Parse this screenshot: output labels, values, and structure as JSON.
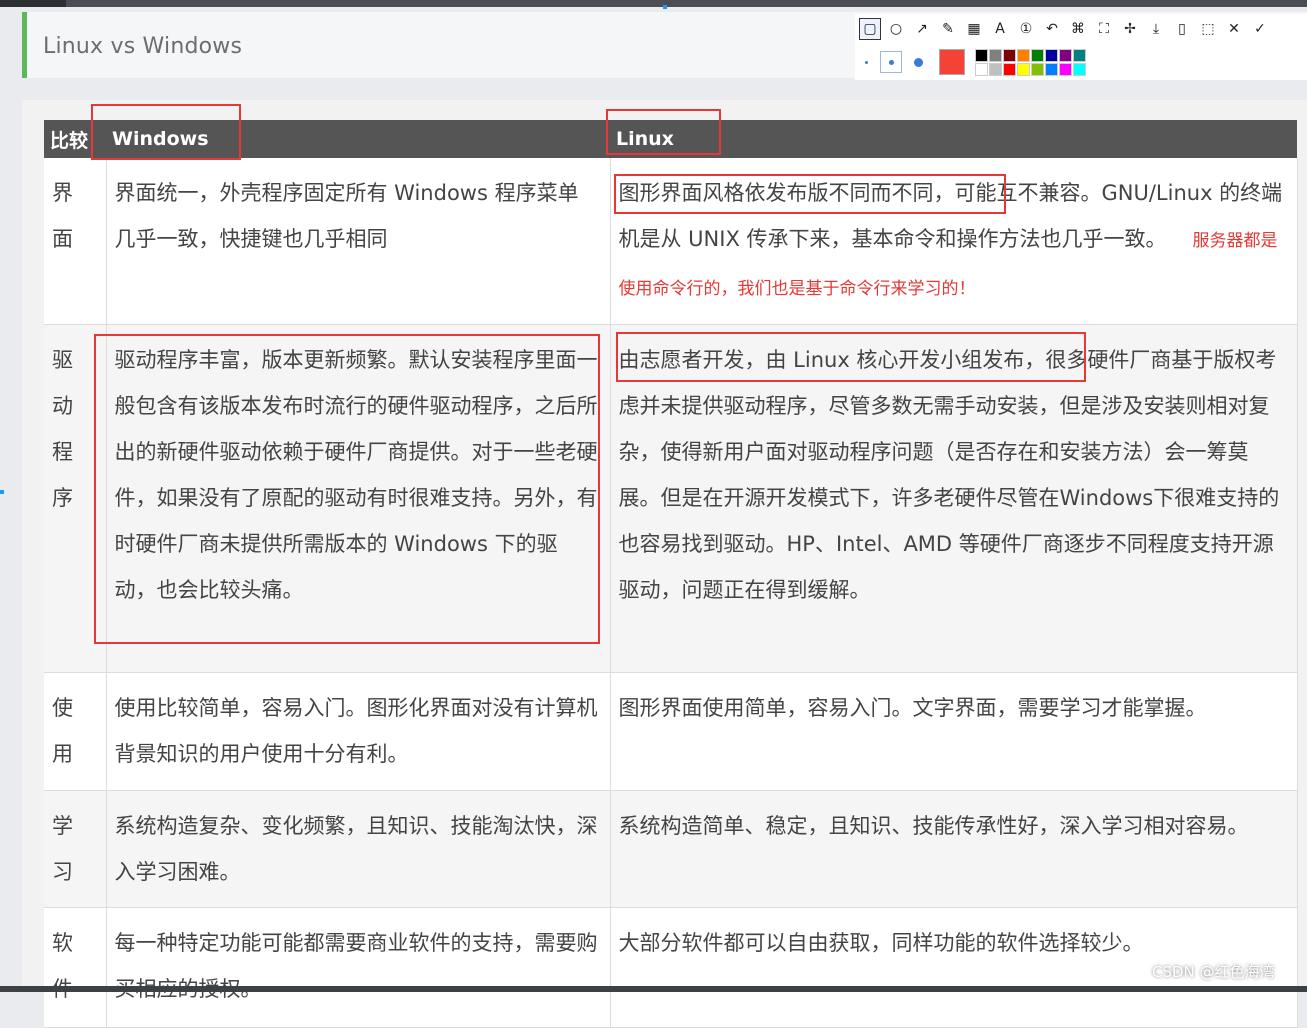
{
  "heading": {
    "title": "Linux vs Windows"
  },
  "toolbar": {
    "tools": [
      {
        "icon": "rectangle-icon",
        "glyph": "▢",
        "active": true
      },
      {
        "icon": "ellipse-icon",
        "glyph": "○"
      },
      {
        "icon": "arrow-icon",
        "glyph": "↗"
      },
      {
        "icon": "pen-icon",
        "glyph": "✎"
      },
      {
        "icon": "mosaic-icon",
        "glyph": "▦"
      },
      {
        "icon": "text-icon",
        "glyph": "A"
      },
      {
        "icon": "number-marker-icon",
        "glyph": "①"
      },
      {
        "icon": "undo-icon",
        "glyph": "↶"
      },
      {
        "icon": "pin-tool-icon",
        "glyph": "⌘"
      },
      {
        "icon": "crop-icon",
        "glyph": "⛶"
      },
      {
        "icon": "pin-icon",
        "glyph": "✢"
      },
      {
        "icon": "download-icon",
        "glyph": "⤓"
      },
      {
        "icon": "save-icon",
        "glyph": "▯"
      },
      {
        "icon": "bookmark-icon",
        "glyph": "⬚"
      },
      {
        "icon": "close-icon",
        "glyph": "✕"
      },
      {
        "icon": "confirm-icon",
        "glyph": "✓"
      }
    ],
    "selected_color": "#f44336",
    "palette": [
      "#000000",
      "#808080",
      "#800000",
      "#ff8000",
      "#008000",
      "#0000a0",
      "#800080",
      "#008080",
      "#ffffff",
      "#c0c0c0",
      "#ff0000",
      "#ffff00",
      "#80c000",
      "#0080ff",
      "#ff00ff",
      "#00ffff"
    ]
  },
  "table": {
    "headers": [
      "比较",
      "Windows",
      "Linux"
    ],
    "rows": [
      {
        "category": [
          "界",
          "面"
        ],
        "windows": "界面统一，外壳程序固定所有 Windows 程序菜单几乎一致，快捷键也几乎相同",
        "linux": "图形界面风格依发布版不同而不同，可能互不兼容。GNU/Linux 的终端机是从 UNIX 传承下来，基本命令和操作方法也几乎一致。",
        "note": "服务器都是使用命令行的，我们也是基于命令行来学习的！"
      },
      {
        "category": [
          "驱",
          "动",
          "程",
          "序"
        ],
        "windows": "驱动程序丰富，版本更新频繁。默认安装程序里面一般包含有该版本发布时流行的硬件驱动程序，之后所出的新硬件驱动依赖于硬件厂商提供。对于一些老硬件，如果没有了原配的驱动有时很难支持。另外，有时硬件厂商未提供所需版本的 Windows 下的驱动，也会比较头痛。",
        "linux": "由志愿者开发，由 Linux 核心开发小组发布，很多硬件厂商基于版权考虑并未提供驱动程序，尽管多数无需手动安装，但是涉及安装则相对复杂，使得新用户面对驱动程序问题（是否存在和安装方法）会一筹莫展。但是在开源开发模式下，许多老硬件尽管在Windows下很难支持的也容易找到驱动。HP、Intel、AMD 等硬件厂商逐步不同程度支持开源驱动，问题正在得到缓解。"
      },
      {
        "category": [
          "使",
          "用"
        ],
        "windows": "使用比较简单，容易入门。图形化界面对没有计算机背景知识的用户使用十分有利。",
        "linux": "图形界面使用简单，容易入门。文字界面，需要学习才能掌握。"
      },
      {
        "category": [
          "学",
          "习"
        ],
        "windows": "系统构造复杂、变化频繁，且知识、技能淘汰快，深入学习困难。",
        "linux": "系统构造简单、稳定，且知识、技能传承性好，深入学习相对容易。"
      },
      {
        "category": [
          "软",
          "件"
        ],
        "windows": "每一种特定功能可能都需要商业软件的支持，需要购买相应的授权。",
        "linux": "大部分软件都可以自由获取，同样功能的软件选择较少。"
      }
    ]
  },
  "watermark": "CSDN @红色海湾"
}
